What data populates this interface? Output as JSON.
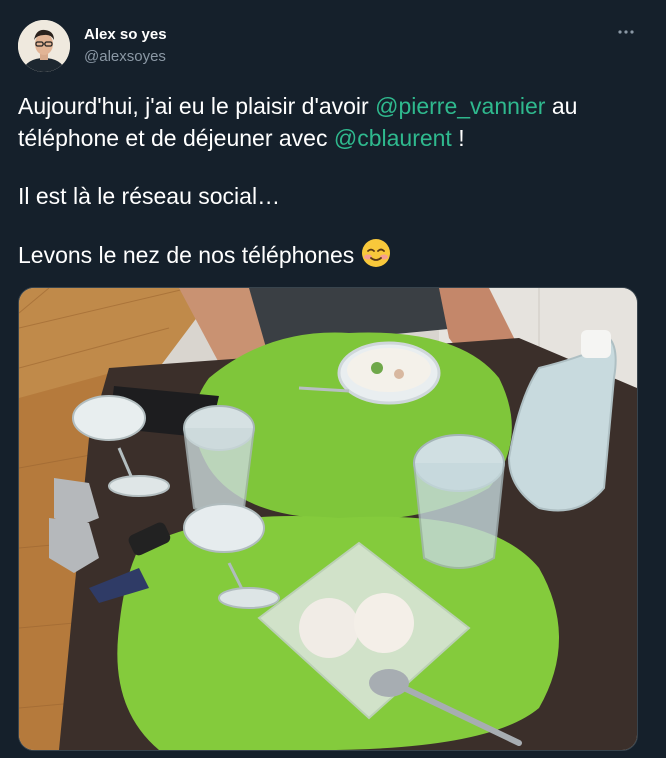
{
  "author": {
    "display_name": "Alex so yes",
    "handle": "@alexsoyes",
    "avatar_icon": "avatar-photo"
  },
  "more_icon": "more-horizontal-icon",
  "tweet": {
    "line1_pre": "Aujourd'hui, j'ai eu le plaisir d'avoir ",
    "mention1": "@pierre_vannier",
    "line1_mid": " au téléphone et de déjeuner avec ",
    "mention2": "@cblaurent",
    "line1_post": " !",
    "line2": "Il est là le réseau social…",
    "line3": "Levons le nez de nos téléphones ",
    "emoji": "smiling-face-with-smiling-eyes"
  },
  "media": {
    "image_icon": "photo-lunch-table"
  },
  "colors": {
    "background": "#15202b",
    "text": "#ffffff",
    "secondary": "#8b98a5",
    "mention": "#2fb98e"
  }
}
